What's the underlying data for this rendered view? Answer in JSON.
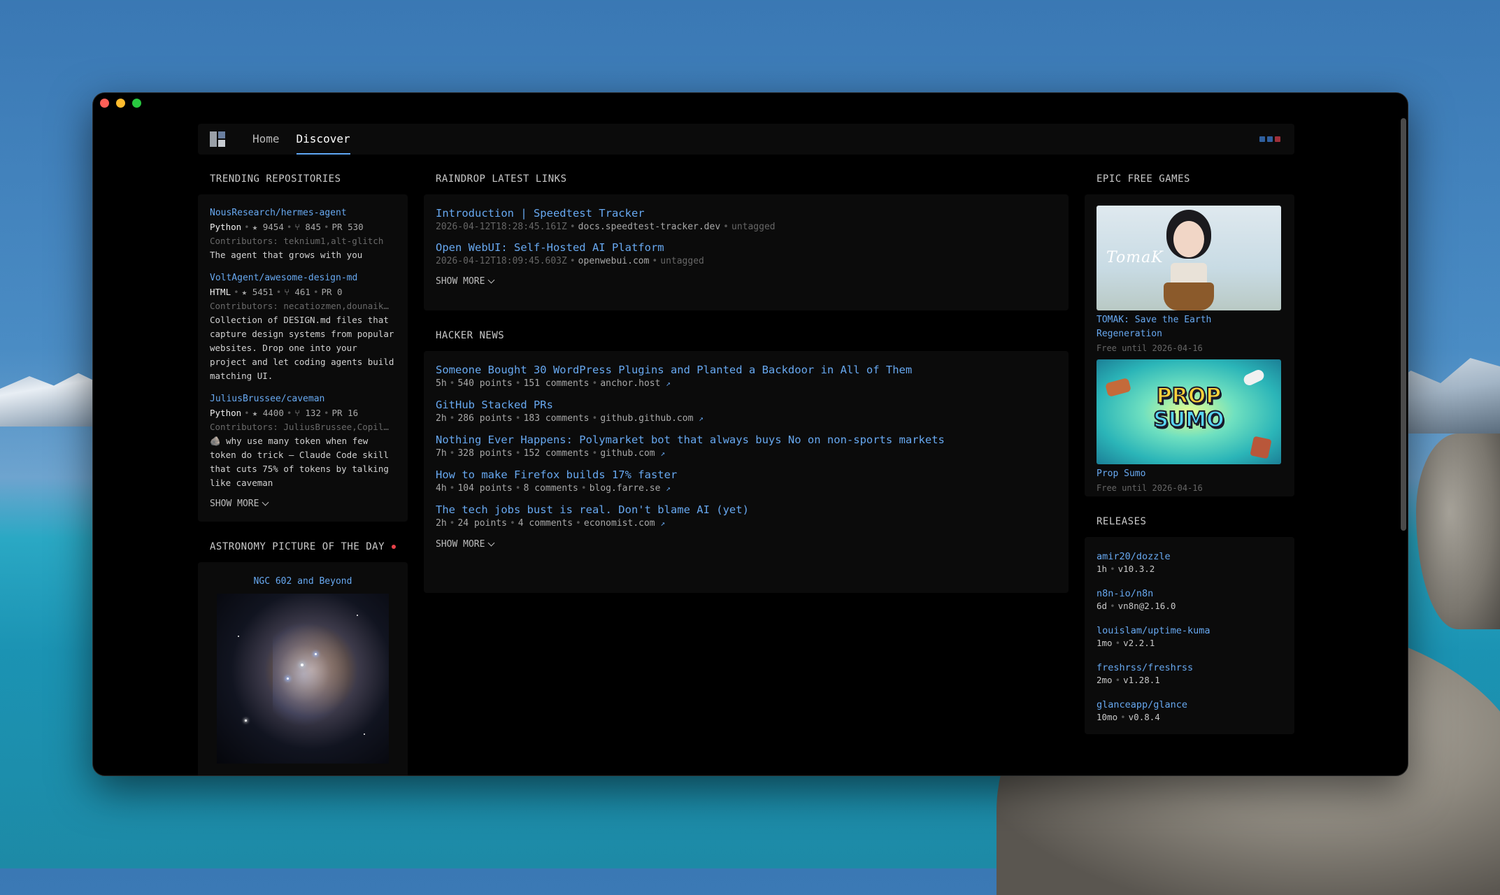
{
  "nav": {
    "home": "Home",
    "discover": "Discover"
  },
  "accent_colors": {
    "link": "#67a8f0",
    "dots": [
      "#2f5f9e",
      "#2f5f9e",
      "#9e2f3a"
    ]
  },
  "trending": {
    "title": "TRENDING REPOSITORIES",
    "repos": [
      {
        "name": "NousResearch/hermes-agent",
        "lang": "Python",
        "stars": "★ 9454",
        "forks": "⑂ 845",
        "prs": "PR 530",
        "contributors": "Contributors: teknium1,alt-glitch",
        "desc": "The agent that grows with you"
      },
      {
        "name": "VoltAgent/awesome-design-md",
        "lang": "HTML",
        "stars": "★ 5451",
        "forks": "⑂ 461",
        "prs": "PR 0",
        "contributors": "Contributors: necatiozmen,dounaikoa",
        "desc": "Collection of DESIGN.md files that capture design systems from popular websites. Drop one into your project and let coding agents build matching UI."
      },
      {
        "name": "JuliusBrussee/caveman",
        "lang": "Python",
        "stars": "★ 4400",
        "forks": "⑂ 132",
        "prs": "PR 16",
        "contributors": "Contributors: JuliusBrussee,Copilot",
        "desc": "🪨 why use many token when few token do trick — Claude Code skill that cuts 75% of tokens by talking like caveman"
      }
    ],
    "show_more": "SHOW MORE"
  },
  "apod": {
    "title": "ASTRONOMY PICTURE OF THE DAY",
    "image_title": "NGC 602 and Beyond"
  },
  "raindrop": {
    "title": "RAINDROP LATEST LINKS",
    "links": [
      {
        "title": "Introduction | Speedtest Tracker",
        "date": "2026-04-12T18:28:45.161Z",
        "domain": "docs.speedtest-tracker.dev",
        "tag": "untagged"
      },
      {
        "title": "Open WebUI: Self-Hosted AI Platform",
        "date": "2026-04-12T18:09:45.603Z",
        "domain": "openwebui.com",
        "tag": "untagged"
      }
    ],
    "show_more": "SHOW MORE"
  },
  "hackernews": {
    "title": "HACKER NEWS",
    "items": [
      {
        "title": "Someone Bought 30 WordPress Plugins and Planted a Backdoor in All of Them",
        "age": "5h",
        "points": "540 points",
        "comments": "151 comments",
        "domain": "anchor.host"
      },
      {
        "title": "GitHub Stacked PRs",
        "age": "2h",
        "points": "286 points",
        "comments": "183 comments",
        "domain": "github.github.com"
      },
      {
        "title": "Nothing Ever Happens: Polymarket bot that always buys No on non-sports markets",
        "age": "7h",
        "points": "328 points",
        "comments": "152 comments",
        "domain": "github.com"
      },
      {
        "title": "How to make Firefox builds 17% faster",
        "age": "4h",
        "points": "104 points",
        "comments": "8 comments",
        "domain": "blog.farre.se"
      },
      {
        "title": "The tech jobs bust is real. Don't blame AI (yet)",
        "age": "2h",
        "points": "24 points",
        "comments": "4 comments",
        "domain": "economist.com"
      }
    ],
    "show_more": "SHOW MORE"
  },
  "epic": {
    "title": "EPIC FREE GAMES",
    "games": [
      {
        "title": "TOMAK: Save the Earth Regeneration",
        "free_until": "Free until 2026-04-16",
        "logo_text": "TomaK"
      },
      {
        "title": "Prop Sumo",
        "free_until": "Free until 2026-04-16",
        "logo_text_1": "PROP",
        "logo_text_2": "SUMO"
      }
    ]
  },
  "releases": {
    "title": "RELEASES",
    "items": [
      {
        "name": "amir20/dozzle",
        "age": "1h",
        "version": "v10.3.2"
      },
      {
        "name": "n8n-io/n8n",
        "age": "6d",
        "version": "vn8n@2.16.0"
      },
      {
        "name": "louislam/uptime-kuma",
        "age": "1mo",
        "version": "v2.2.1"
      },
      {
        "name": "freshrss/freshrss",
        "age": "2mo",
        "version": "v1.28.1"
      },
      {
        "name": "glanceapp/glance",
        "age": "10mo",
        "version": "v0.8.4"
      }
    ]
  }
}
